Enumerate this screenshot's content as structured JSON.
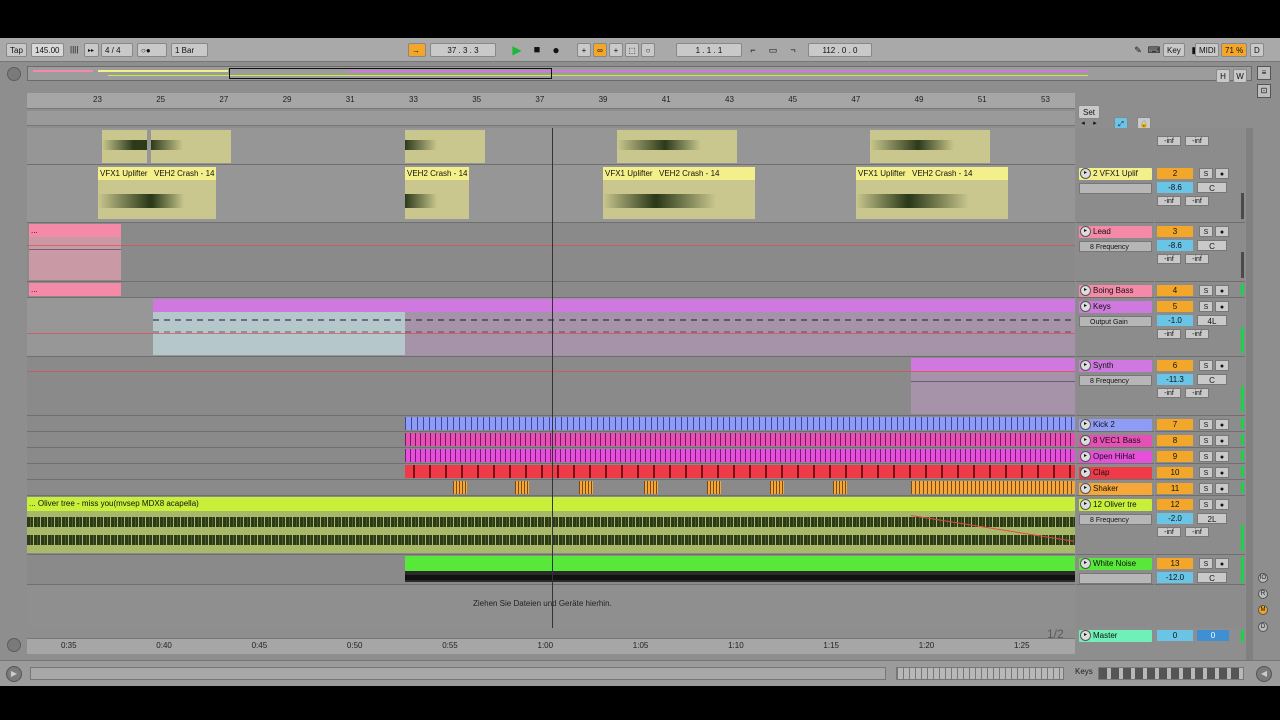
{
  "transport": {
    "tap_label": "Tap",
    "tempo": "145.00",
    "meter_marks": "||||",
    "time_signature": "4 / 4",
    "metronome": "○●",
    "quantize": "1 Bar",
    "position": "37 .   3 .   3",
    "loop_start": "1 .   1 .   1",
    "loop_length": "112 .   0 .   0",
    "key_label": "Key",
    "midi_label": "MIDI",
    "cpu": "71 %",
    "d_label": "D"
  },
  "overview": {
    "h_label": "H",
    "w_label": "W"
  },
  "ruler": {
    "bars": [
      "23",
      "25",
      "27",
      "29",
      "31",
      "33",
      "35",
      "37",
      "39",
      "41",
      "43",
      "45",
      "47",
      "49",
      "51",
      "53"
    ],
    "set_label": "Set"
  },
  "time_ruler": {
    "times": [
      "0:35",
      "0:40",
      "0:45",
      "0:50",
      "0:55",
      "1:00",
      "1:05",
      "1:10",
      "1:15",
      "1:20",
      "1:25"
    ],
    "page": "1/2"
  },
  "clips": {
    "vfx1_a": "VFX1 Uplifter",
    "veh2_a": "VEH2 Crash - 14",
    "veh2_b": "VEH2 Crash - 14",
    "vfx1_b": "VFX1 Uplifter",
    "veh2_c": "VEH2 Crash - 14",
    "vfx1_c": "VFX1 Uplifter",
    "veh2_d": "VEH2 Crash - 14",
    "lead_clip": "...",
    "boing_clip": "...",
    "vocal_clip": "... Oliver tree - miss you(mvsep MDX8 acapella)"
  },
  "drop_hint": "Ziehen Sie Dateien und Geräte hierhin.",
  "tracks": [
    {
      "name": "2 VFX1 Uplif",
      "num": "2",
      "vol": "-8.6",
      "pan": "C",
      "color": "#f3ef8a",
      "device": ""
    },
    {
      "name": "Lead",
      "num": "3",
      "vol": "-8.6",
      "pan": "C",
      "color": "#f58aa8",
      "device": "8 Frequency"
    },
    {
      "name": "Boing Bass",
      "num": "4",
      "vol": "",
      "pan": "",
      "color": "#f58aa8",
      "device": ""
    },
    {
      "name": "Keys",
      "num": "5",
      "vol": "-1.0",
      "pan": "4L",
      "color": "#cf78e0",
      "device": "Output Gain"
    },
    {
      "name": "Synth",
      "num": "6",
      "vol": "-11.3",
      "pan": "C",
      "color": "#cf78e0",
      "device": "8 Frequency"
    },
    {
      "name": "Kick 2",
      "num": "7",
      "vol": "",
      "pan": "",
      "color": "#8f9cf5",
      "device": ""
    },
    {
      "name": "8 VEC1 Bass",
      "num": "8",
      "vol": "",
      "pan": "",
      "color": "#e64fb5",
      "device": ""
    },
    {
      "name": "Open HiHat",
      "num": "9",
      "vol": "",
      "pan": "",
      "color": "#e64fdc",
      "device": ""
    },
    {
      "name": "Clap",
      "num": "10",
      "vol": "",
      "pan": "",
      "color": "#f03a48",
      "device": ""
    },
    {
      "name": "Shaker",
      "num": "11",
      "vol": "",
      "pan": "",
      "color": "#f5a73a",
      "device": ""
    },
    {
      "name": "12 Oliver tre",
      "num": "12",
      "vol": "-2.0",
      "pan": "2L",
      "color": "#c8f03a",
      "device": "8 Frequency"
    },
    {
      "name": "White Noise",
      "num": "13",
      "vol": "-12.0",
      "pan": "C",
      "color": "#57e83a",
      "device": ""
    }
  ],
  "top_mixer": {
    "inf_a": "-inf",
    "inf_b": "-inf"
  },
  "mixer_labels": {
    "solo": "S",
    "inf": "-inf"
  },
  "master": {
    "name": "Master",
    "vol": "0",
    "pan": "0",
    "color": "#6ff0b8"
  },
  "status": {
    "keys_label": "Keys"
  }
}
